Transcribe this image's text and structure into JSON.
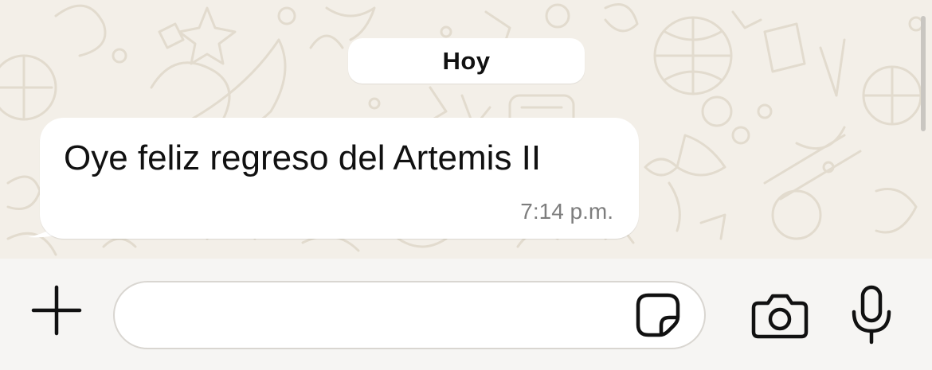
{
  "chat": {
    "date_chip": "Hoy",
    "messages": [
      {
        "text": "Oye feliz regreso del Artemis II",
        "time": "7:14 p.m.",
        "direction": "incoming"
      }
    ]
  },
  "composer": {
    "input_value": "",
    "icons": {
      "attach": "plus-icon",
      "sticker": "sticker-icon",
      "camera": "camera-icon",
      "mic": "microphone-icon"
    }
  },
  "colors": {
    "chat_background": "#f3efe8",
    "doodle": "#e3dccf",
    "bubble_incoming": "#ffffff",
    "timestamp": "#7d7d7d",
    "composer_background": "#f6f5f3",
    "icon": "#111111"
  }
}
